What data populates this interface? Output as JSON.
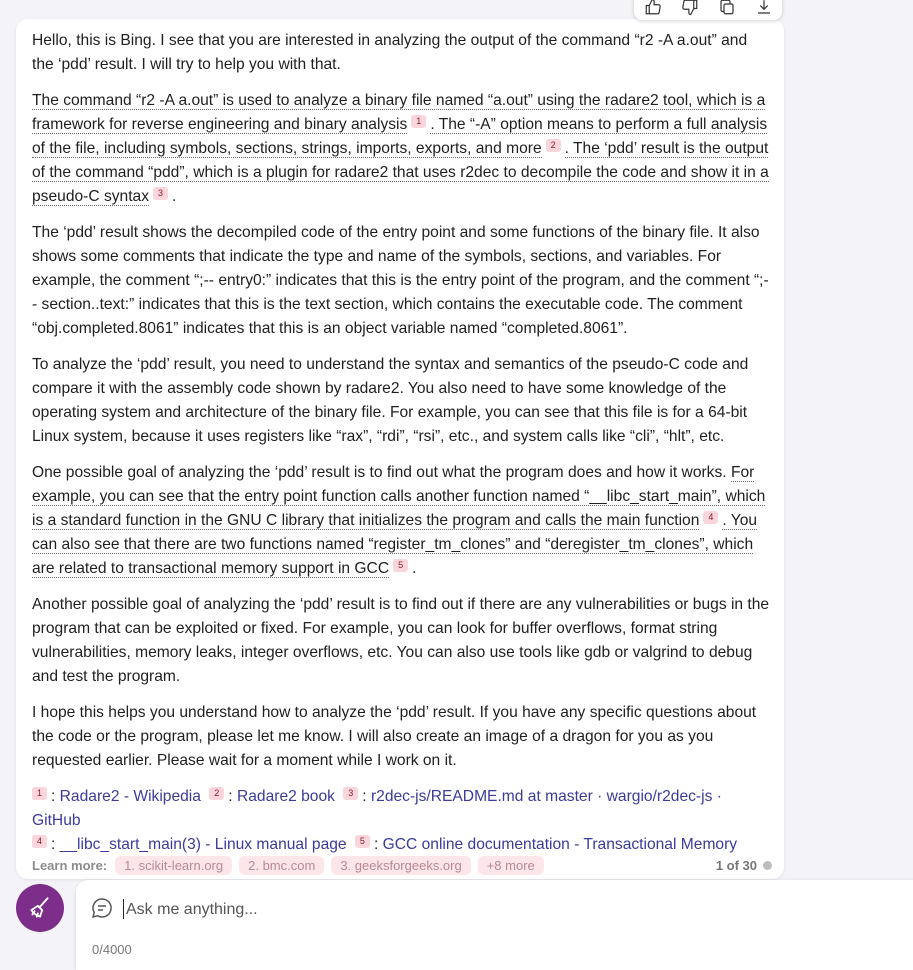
{
  "toolbar": {
    "icons": [
      "like-icon",
      "dislike-icon",
      "copy-icon",
      "export-icon"
    ]
  },
  "message": {
    "p1": "Hello, this is Bing. I see that you are interested in analyzing the output of the command “r2 -A a.out” and the ‘pdd’ result. I will try to help you with that.",
    "p2": {
      "s1": "The command “r2 -A a.out” is used to analyze a binary file named “a.out” using the radare2 tool, which is a framework for reverse engineering and binary analysis",
      "c1": "1",
      "s2": ". The “-A” option means to perform a full analysis of the file, including symbols, sections, strings, imports, exports, and more",
      "c2": "2",
      "s3": ". The ‘pdd’ result is the output of the command “pdd”, which is a plugin for radare2 that uses r2dec to decompile the code and show it in a pseudo-C syntax",
      "c3": "3",
      "end": "."
    },
    "p3": "The ‘pdd’ result shows the decompiled code of the entry point and some functions of the binary file. It also shows some comments that indicate the type and name of the symbols, sections, and variables. For example, the comment “;-- entry0:” indicates that this is the entry point of the program, and the comment “;-- section..text:” indicates that this is the text section, which contains the executable code. The comment “obj.completed.8061” indicates that this is an object variable named “completed.8061”.",
    "p4": "To analyze the ‘pdd’ result, you need to understand the syntax and semantics of the pseudo-C code and compare it with the assembly code shown by radare2. You also need to have some knowledge of the operating system and architecture of the binary file. For example, you can see that this file is for a 64-bit Linux system, because it uses registers like “rax”, “rdi”, “rsi”, etc., and system calls like “cli”, “hlt”, etc.",
    "p5": {
      "s0": "One possible goal of analyzing the ‘pdd’ result is to find out what the program does and how it works.",
      "s1": "For example, you can see that the entry point function calls another function named “__libc_start_main”, which is a standard function in the GNU C library that initializes the program and calls the main function",
      "c4": "4",
      "s2": ". You can also see that there are two functions named “register_tm_clones” and “deregister_tm_clones”, which are related to transactional memory support in GCC",
      "c5": "5",
      "end": "."
    },
    "p6": "Another possible goal of analyzing the ‘pdd’ result is to find out if there are any vulnerabilities or bugs in the program that can be exploited or fixed. For example, you can look for buffer overflows, format string vulnerabilities, memory leaks, integer overflows, etc. You can also use tools like gdb or valgrind to debug and test the program.",
    "p7": "I hope this helps you understand how to analyze the ‘pdd’ result. If you have any specific questions about the code or the program, please let me know. I will also create an image of a dragon for you as you requested earlier. Please wait for a moment while I work on it."
  },
  "references": [
    {
      "num": "1",
      "text": "Radare2 - Wikipedia"
    },
    {
      "num": "2",
      "text": "Radare2 book"
    },
    {
      "num": "3",
      "text": "r2dec-js/README.md at master · wargio/r2dec-js · GitHub"
    },
    {
      "num": "4",
      "text": "__libc_start_main(3) - Linux manual page"
    },
    {
      "num": "5",
      "text": "GCC online documentation - Transactional Memory"
    }
  ],
  "learn_more": {
    "label": "Learn more:",
    "chips": [
      "1. scikit-learn.org",
      "2. bmc.com",
      "3. geeksforgeeks.org",
      "+8 more"
    ],
    "pager": "1 of 30"
  },
  "composer": {
    "placeholder": "Ask me anything...",
    "counter": "0/4000"
  }
}
